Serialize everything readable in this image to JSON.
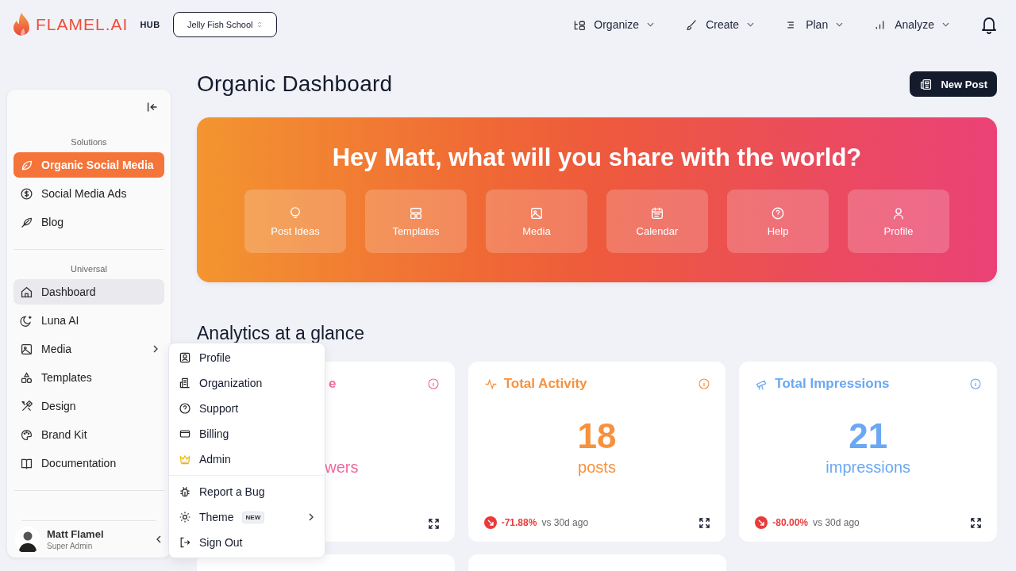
{
  "brand": {
    "logo_text": "FLAMEL.AI",
    "hub": "HUB"
  },
  "workspace": "Jelly Fish School",
  "nav": [
    {
      "label": "Organize"
    },
    {
      "label": "Create"
    },
    {
      "label": "Plan"
    },
    {
      "label": "Analyze"
    }
  ],
  "sidebar": {
    "sections": [
      {
        "heading": "Solutions",
        "items": [
          {
            "label": "Organic Social Media",
            "selected": true,
            "submenu": false
          },
          {
            "label": "Social Media Ads",
            "selected": false,
            "submenu": false
          },
          {
            "label": "Blog",
            "selected": false,
            "submenu": false
          }
        ]
      },
      {
        "heading": "Universal",
        "items": [
          {
            "label": "Dashboard",
            "selected": false,
            "hovered": true,
            "submenu": false
          },
          {
            "label": "Luna AI",
            "selected": false,
            "submenu": false
          },
          {
            "label": "Media",
            "selected": false,
            "submenu": true
          },
          {
            "label": "Templates",
            "selected": false,
            "submenu": false
          },
          {
            "label": "Design",
            "selected": false,
            "submenu": false
          },
          {
            "label": "Brand Kit",
            "selected": false,
            "submenu": false
          },
          {
            "label": "Documentation",
            "selected": false,
            "submenu": false
          }
        ]
      }
    ],
    "user": {
      "name": "Matt Flamel",
      "role": "Super Admin"
    }
  },
  "user_menu": {
    "groups": [
      [
        {
          "label": "Profile"
        },
        {
          "label": "Organization"
        },
        {
          "label": "Support"
        },
        {
          "label": "Billing"
        },
        {
          "label": "Admin"
        }
      ],
      [
        {
          "label": "Report a Bug"
        },
        {
          "label": "Theme",
          "badge": "NEW",
          "submenu": true
        },
        {
          "label": "Sign Out"
        }
      ]
    ]
  },
  "page": {
    "title": "Organic Dashboard",
    "new_post": "New Post"
  },
  "banner": {
    "heading": "Hey Matt, what will you share with the world?",
    "actions": [
      {
        "label": "Post Ideas"
      },
      {
        "label": "Templates"
      },
      {
        "label": "Media"
      },
      {
        "label": "Calendar"
      },
      {
        "label": "Help"
      },
      {
        "label": "Profile"
      }
    ]
  },
  "analytics": {
    "heading": "Analytics at a glance",
    "cards": [
      {
        "title": "e",
        "unit": "wers",
        "color": "#f2699f"
      },
      {
        "title": "Total Activity",
        "value": "18",
        "unit": "posts",
        "change": "-71.88%",
        "compare": "vs 30d ago",
        "color": "#f7913d"
      },
      {
        "title": "Total Impressions",
        "value": "21",
        "unit": "impressions",
        "change": "-80.00%",
        "compare": "vs 30d ago",
        "color": "#6aa8f2"
      }
    ]
  }
}
